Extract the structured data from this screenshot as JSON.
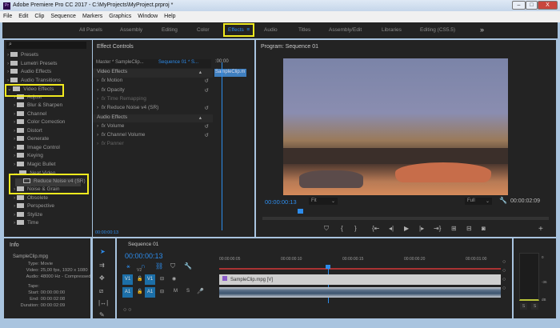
{
  "window": {
    "title": "Adobe Premiere Pro CC 2017 - C:\\MyProjects\\MyProject.prproj *",
    "app_icon": "Pr",
    "minimize": "–",
    "maximize": "□",
    "close": "X"
  },
  "menu": [
    "File",
    "Edit",
    "Clip",
    "Sequence",
    "Markers",
    "Graphics",
    "Window",
    "Help"
  ],
  "workspaces": {
    "items": [
      "All Panels",
      "Assembly",
      "Editing",
      "Color",
      "Effects",
      "Audio",
      "Titles",
      "Assembly/Edit",
      "Libraries",
      "Editing (CS5.5)"
    ],
    "active": "Effects",
    "more": "»",
    "menu_icon": "≡"
  },
  "effects_panel": {
    "search_placeholder": "",
    "tree": [
      {
        "label": "Presets",
        "level": 0
      },
      {
        "label": "Lumetri Presets",
        "level": 0
      },
      {
        "label": "Audio Effects",
        "level": 0
      },
      {
        "label": "Audio Transitions",
        "level": 0
      },
      {
        "label": "Video Effects",
        "level": 0,
        "open": true
      },
      {
        "label": "Adjust",
        "level": 1
      },
      {
        "label": "Blur & Sharpen",
        "level": 1
      },
      {
        "label": "Channel",
        "level": 1
      },
      {
        "label": "Color Correction",
        "level": 1
      },
      {
        "label": "Distort",
        "level": 1
      },
      {
        "label": "Generate",
        "level": 1
      },
      {
        "label": "Image Control",
        "level": 1
      },
      {
        "label": "Keying",
        "level": 1
      },
      {
        "label": "Magic Bullet",
        "level": 1
      },
      {
        "label": "Neat Video",
        "level": 1,
        "open": true
      },
      {
        "label": "Reduce Noise v4 (SR)",
        "level": 2
      },
      {
        "label": "Noise & Grain",
        "level": 1
      },
      {
        "label": "Obsolete",
        "level": 1
      },
      {
        "label": "Perspective",
        "level": 1
      },
      {
        "label": "Stylize",
        "level": 1
      },
      {
        "label": "Time",
        "level": 1
      }
    ]
  },
  "effect_controls": {
    "title": "Effect Controls",
    "master": "Master * SampleClip...",
    "sequence": "Sequence 01 * S...",
    "ruler_time": ":00:00",
    "clip": "SampleClip.m",
    "video_section": "Video Effects",
    "audio_section": "Audio Effects",
    "video": [
      "Motion",
      "Opacity",
      "Time Remapping",
      "Reduce Noise v4 (SR)"
    ],
    "audio": [
      "Volume",
      "Channel Volume",
      "Panner"
    ],
    "fx": "fx",
    "timecode": "00:00:00:13"
  },
  "program": {
    "title": "Program: Sequence 01",
    "timecode": "00:00:00:13",
    "fit": "Fit",
    "quality": "Full",
    "duration": "00:00:02:09",
    "playhead_fraction": 0.13
  },
  "info": {
    "title": "Info",
    "clip": "SampleClip.mpg",
    "fields": [
      [
        "Type:",
        "Movie"
      ],
      [
        "Video:",
        "25,00 fps, 1920 x 1080"
      ],
      [
        "Audio:",
        "48000 Hz - Compressed"
      ],
      [
        "Tape:",
        ""
      ],
      [
        "Start:",
        "00:00:00:00"
      ],
      [
        "End:",
        "00:00:02:08"
      ],
      [
        "Duration:",
        "00:00:02:09"
      ]
    ]
  },
  "timeline": {
    "title": "Sequence 01",
    "timecode": "00:00:00:13",
    "ruler": [
      "00:00:00:05",
      "00:00:00:10",
      "00:00:00:15",
      "00:00:00:20",
      "00:00:01:00"
    ],
    "video_clip": "SampleClip.mpg [V]",
    "tracks": {
      "v1": "V1",
      "v2": "V2",
      "a1": "A1",
      "m": "M",
      "s": "S"
    }
  },
  "meters": {
    "labels": [
      "0",
      "-36",
      "dB"
    ],
    "solo": [
      "S",
      "S"
    ]
  }
}
